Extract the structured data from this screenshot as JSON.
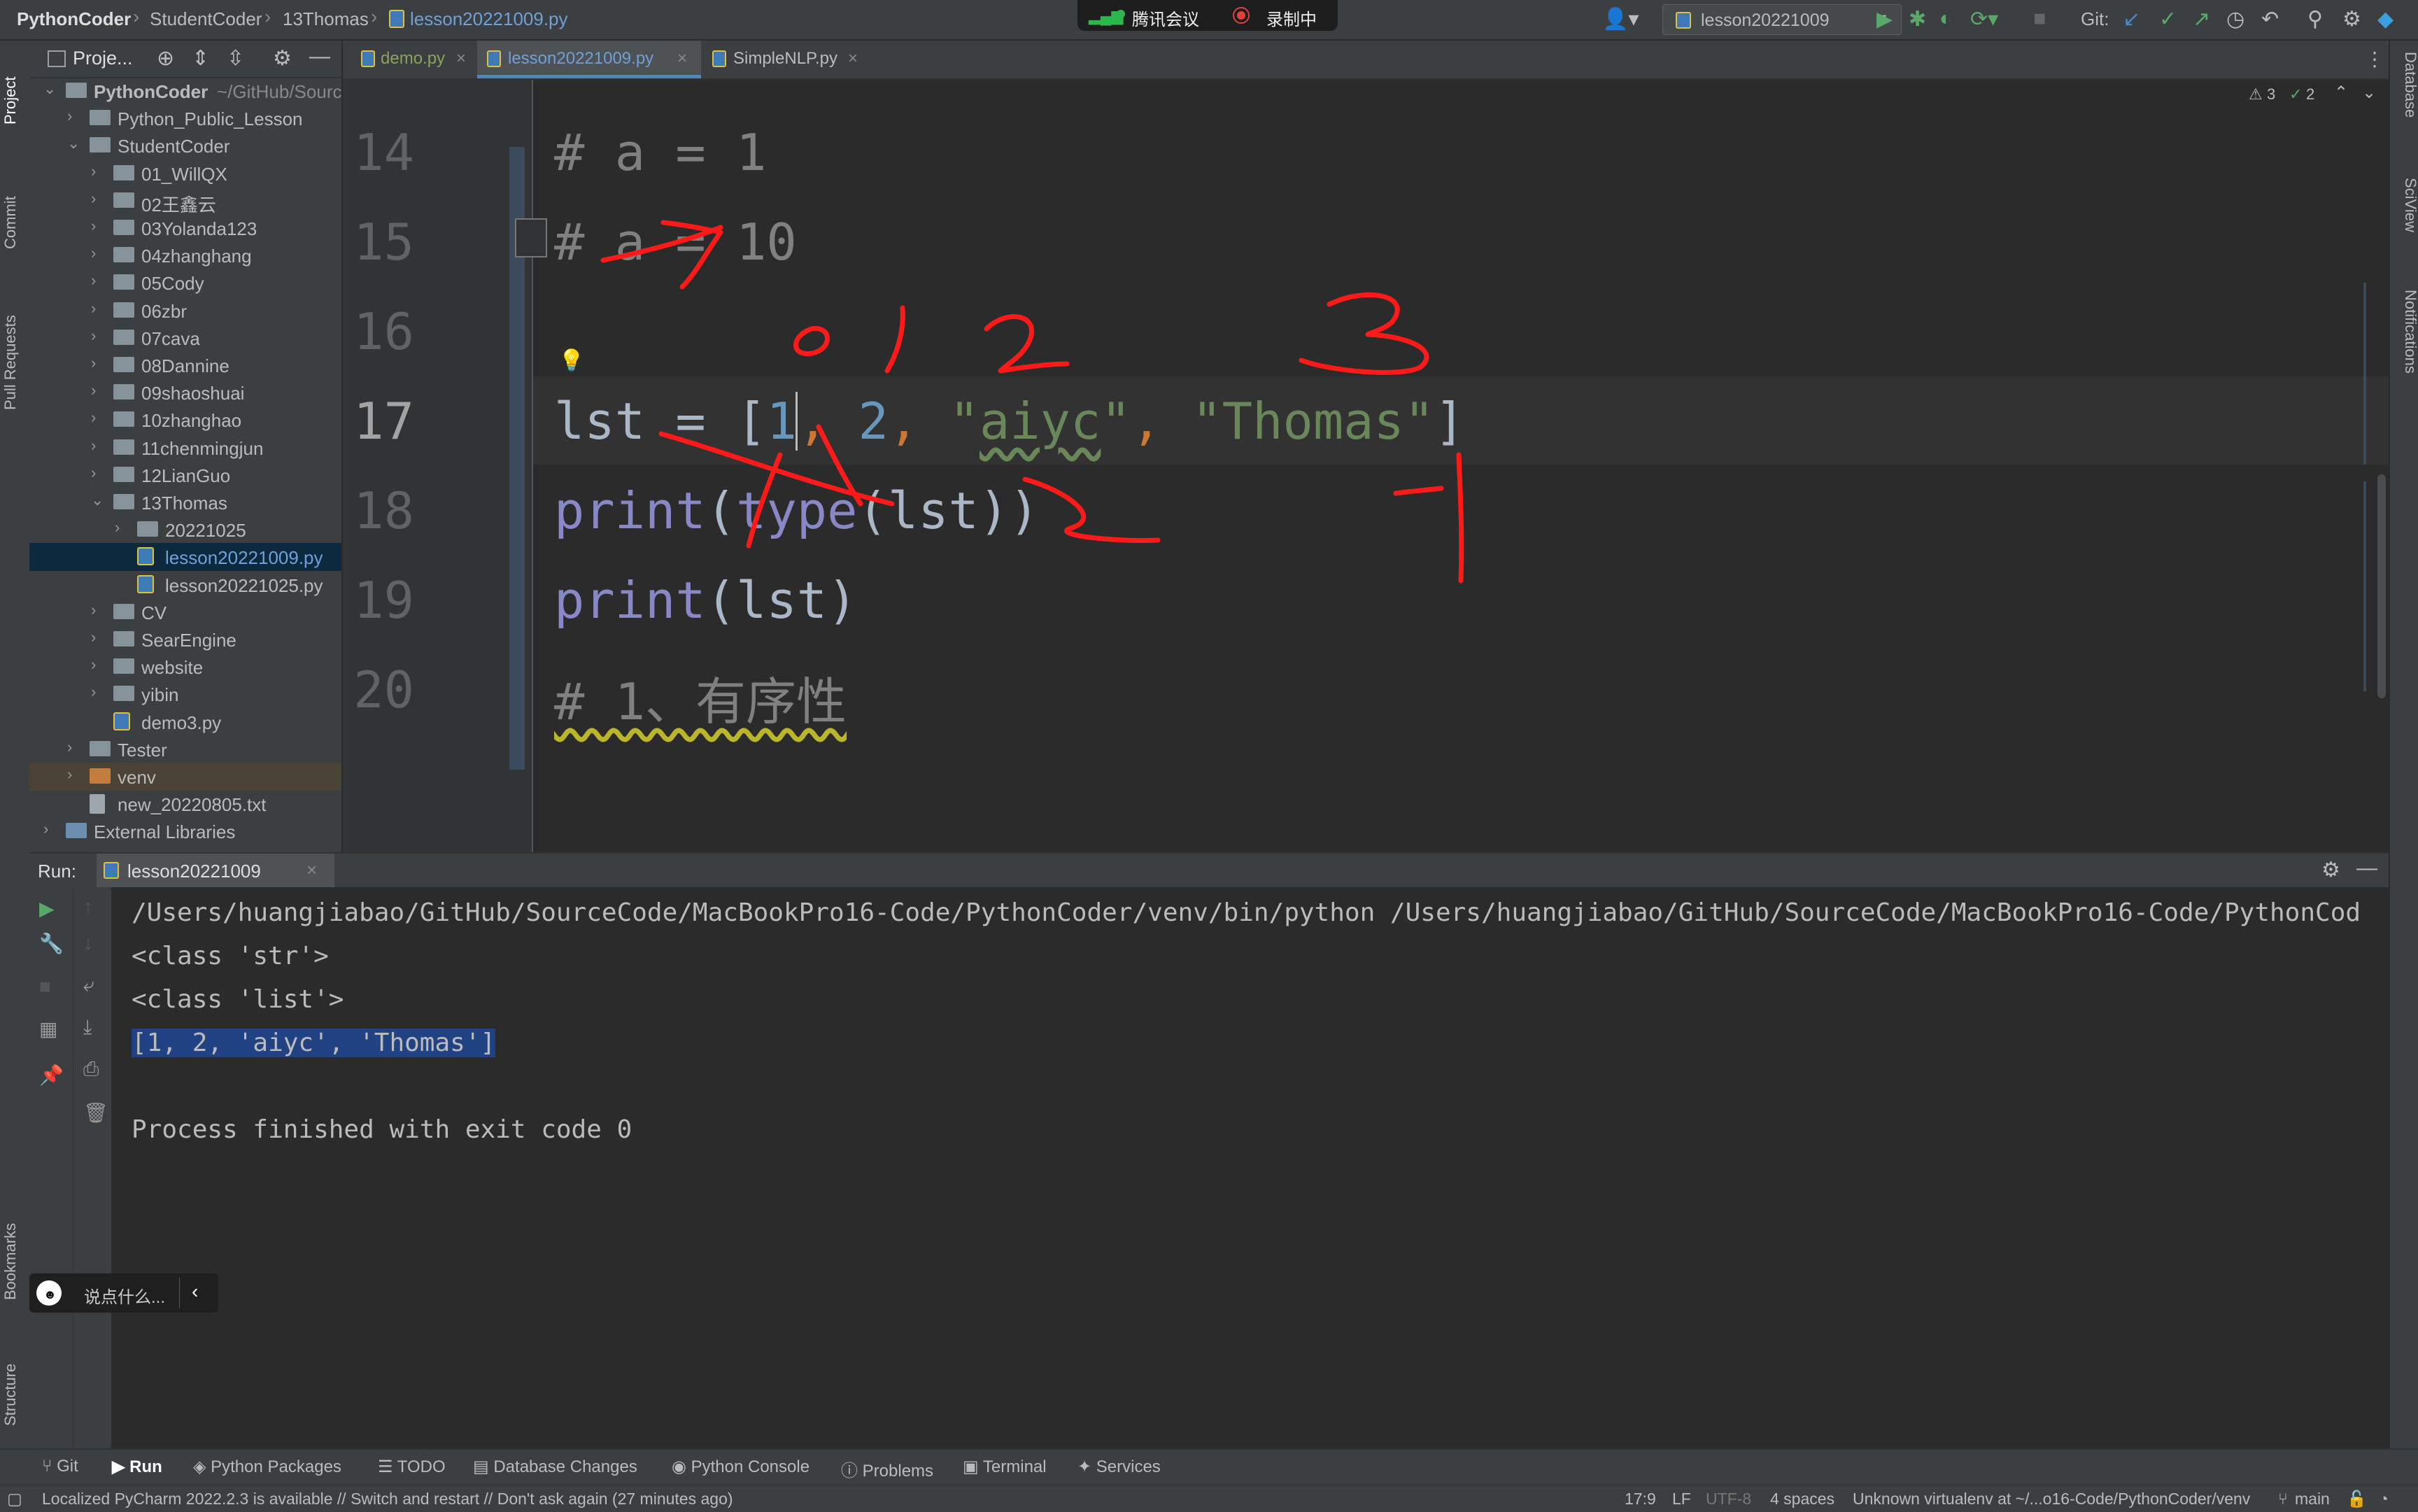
{
  "breadcrumb": [
    "PythonCoder",
    "StudentCoder",
    "13Thomas",
    "lesson20221009.py"
  ],
  "meeting": {
    "app": "腾讯会议",
    "recording": "录制中"
  },
  "run_config": "lesson20221009",
  "git_label": "Git:",
  "project_panel": {
    "title": "Proje...",
    "tree": [
      {
        "label": "PythonCoder",
        "suffix": "~/GitHub/Sourc",
        "depth": 0,
        "type": "folder",
        "open": true
      },
      {
        "label": "Python_Public_Lesson",
        "depth": 1,
        "type": "folder"
      },
      {
        "label": "StudentCoder",
        "depth": 1,
        "type": "folder",
        "open": true
      },
      {
        "label": "01_WillQX",
        "depth": 2,
        "type": "folder"
      },
      {
        "label": "02王鑫云",
        "depth": 2,
        "type": "folder"
      },
      {
        "label": "03Yolanda123",
        "depth": 2,
        "type": "folder"
      },
      {
        "label": "04zhanghang",
        "depth": 2,
        "type": "folder"
      },
      {
        "label": "05Cody",
        "depth": 2,
        "type": "folder"
      },
      {
        "label": "06zbr",
        "depth": 2,
        "type": "folder"
      },
      {
        "label": "07cava",
        "depth": 2,
        "type": "folder"
      },
      {
        "label": "08Dannine",
        "depth": 2,
        "type": "folder"
      },
      {
        "label": "09shaoshuai",
        "depth": 2,
        "type": "folder"
      },
      {
        "label": "10zhanghao",
        "depth": 2,
        "type": "folder"
      },
      {
        "label": "11chenmingjun",
        "depth": 2,
        "type": "folder"
      },
      {
        "label": "12LianGuo",
        "depth": 2,
        "type": "folder"
      },
      {
        "label": "13Thomas",
        "depth": 2,
        "type": "folder",
        "open": true
      },
      {
        "label": "20221025",
        "depth": 3,
        "type": "folder"
      },
      {
        "label": "lesson20221009.py",
        "depth": 3,
        "type": "py",
        "selected": true
      },
      {
        "label": "lesson20221025.py",
        "depth": 3,
        "type": "py"
      },
      {
        "label": "CV",
        "depth": 2,
        "type": "folder"
      },
      {
        "label": "SearEngine",
        "depth": 2,
        "type": "folder"
      },
      {
        "label": "website",
        "depth": 2,
        "type": "folder"
      },
      {
        "label": "yibin",
        "depth": 2,
        "type": "folder"
      },
      {
        "label": "demo3.py",
        "depth": 2,
        "type": "py"
      },
      {
        "label": "Tester",
        "depth": 1,
        "type": "folder"
      },
      {
        "label": "venv",
        "depth": 1,
        "type": "folder-orange",
        "highlight": true
      },
      {
        "label": "new_20220805.txt",
        "depth": 1,
        "type": "txt"
      },
      {
        "label": "External Libraries",
        "depth": 0,
        "type": "lib"
      }
    ]
  },
  "editor": {
    "tabs": [
      "demo.py",
      "lesson20221009.py",
      "SimpleNLP.py"
    ],
    "inspections": {
      "warnings": "3",
      "weak_warnings": "2"
    },
    "lines": [
      {
        "num": "14",
        "text": "# a = 1"
      },
      {
        "num": "15",
        "text": "# a = 10"
      },
      {
        "num": "16",
        "text": ""
      },
      {
        "num": "17",
        "text": "lst = [1, 2, \"aiyc\", \"Thomas\"]"
      },
      {
        "num": "18",
        "text": "print(type(lst))"
      },
      {
        "num": "19",
        "text": "print(lst)"
      },
      {
        "num": "20",
        "text": "# 1、有序性"
      }
    ]
  },
  "run_panel": {
    "label": "Run:",
    "tab": "lesson20221009",
    "output": [
      "/Users/huangjiabao/GitHub/SourceCode/MacBookPro16-Code/PythonCoder/venv/bin/python /Users/huangjiabao/GitHub/SourceCode/MacBookPro16-Code/PythonCod",
      "<class 'str'>",
      "<class 'list'>",
      "[1, 2, 'aiyc', 'Thomas']",
      "",
      "Process finished with exit code 0"
    ]
  },
  "chat_input": {
    "placeholder": "说点什么..."
  },
  "left_strip": [
    "Project",
    "Commit",
    "Pull Requests",
    "Bookmarks",
    "Structure"
  ],
  "right_strip": [
    "Database",
    "SciView",
    "Notifications"
  ],
  "bottom_tabs": [
    "Git",
    "Run",
    "Python Packages",
    "TODO",
    "Database Changes",
    "Python Console",
    "Problems",
    "Terminal",
    "Services"
  ],
  "status": {
    "message": "Localized PyCharm 2022.2.3 is available // Switch and restart // Don't ask again (27 minutes ago)",
    "position": "17:9",
    "line_sep": "LF",
    "encoding": "UTF-8",
    "indent": "4 spaces",
    "interpreter": "Unknown virtualenv at ~/...o16-Code/PythonCoder/venv",
    "branch": "main"
  },
  "annotations": {
    "digits": [
      "0",
      "1",
      "2",
      "3"
    ],
    "negative": "-1",
    "negative2": "-2"
  },
  "colors": {
    "accent": "#4a88c7",
    "annotation": "#ff1a1a",
    "selection": "#214283"
  }
}
